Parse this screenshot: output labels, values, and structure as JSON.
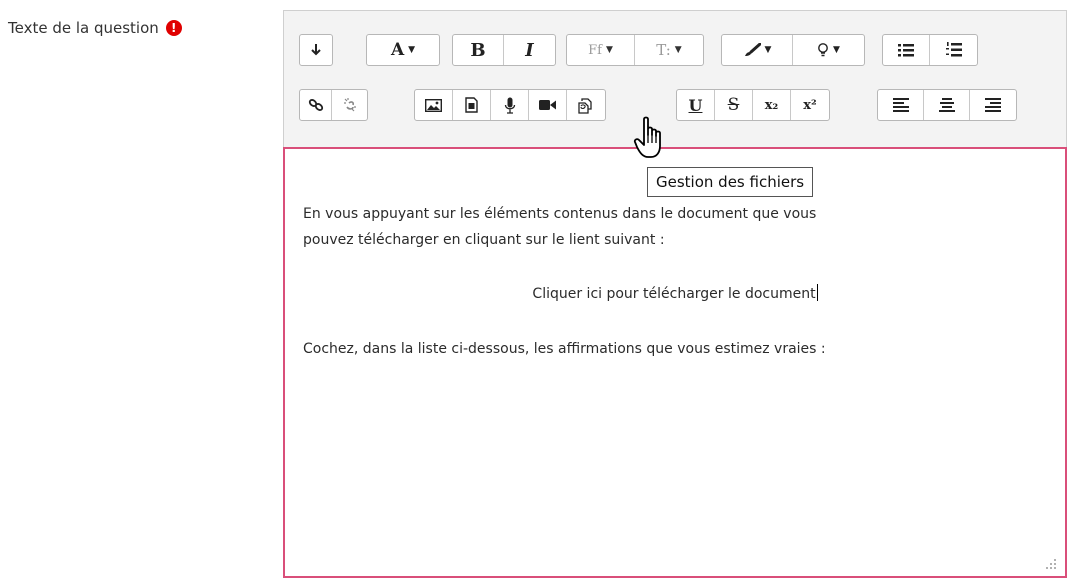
{
  "field": {
    "label": "Texte de la question",
    "required_icon": "exclamation-circle-icon"
  },
  "toolbar": {
    "row1": {
      "collapse_icon": "↧",
      "font_color_label": "A",
      "bold_label": "B",
      "italic_label": "I",
      "font_family_label": "Ff",
      "font_size_label": "T:",
      "brush_icon": "paintbrush-icon",
      "bulb_icon": "lightbulb-icon",
      "ul_icon": "unordered-list-icon",
      "ol_icon": "ordered-list-icon"
    },
    "row2": {
      "link_icon": "link-icon",
      "unlink_icon": "unlink-icon",
      "image_icon": "image-icon",
      "media_icon": "media-file-icon",
      "mic_icon": "microphone-icon",
      "video_icon": "video-camera-icon",
      "file_manager_icon": "manage-files-icon",
      "underline_label": "U",
      "strike_label": "S",
      "subscript_label": "x₂",
      "superscript_label": "x²",
      "align_left_icon": "align-left-icon",
      "align_center_icon": "align-center-icon",
      "align_right_icon": "align-right-icon"
    }
  },
  "tooltip": {
    "text": "Gestion des fichiers"
  },
  "content": {
    "line1": "En vous appuyant sur les éléments contenus dans le document que vous",
    "line2": "pouvez télécharger en cliquant sur le lient suivant :",
    "link": "Cliquer ici pour télécharger le document",
    "instruction": "Cochez, dans la liste ci-dessous, les affirmations que vous estimez vraies :"
  },
  "colors": {
    "content_border": "#d94f7a",
    "required": "#e00000"
  }
}
